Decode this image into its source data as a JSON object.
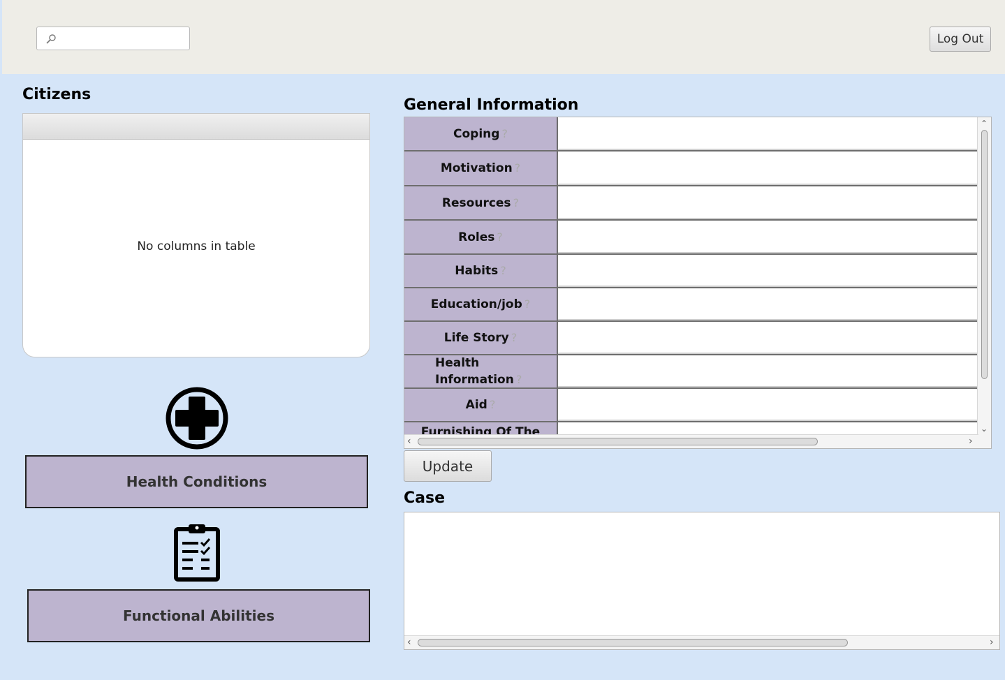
{
  "header": {
    "search": {
      "value": "",
      "placeholder": ""
    },
    "logout_label": "Log Out"
  },
  "citizens": {
    "title": "Citizens",
    "empty_message": "No columns in table"
  },
  "nav": {
    "health_conditions_label": "Health Conditions",
    "health_conditions_icon": "medical-plus-icon",
    "functional_abilities_label": "Functional Abilities",
    "functional_abilities_icon": "clipboard-checklist-icon"
  },
  "general_information": {
    "title": "General Information",
    "help_glyph": "?",
    "rows": [
      {
        "label": "Coping",
        "value": ""
      },
      {
        "label": "Motivation",
        "value": ""
      },
      {
        "label": "Resources",
        "value": ""
      },
      {
        "label": "Roles",
        "value": ""
      },
      {
        "label": "Habits",
        "value": ""
      },
      {
        "label": "Education/job",
        "value": ""
      },
      {
        "label": "Life Story",
        "value": ""
      },
      {
        "label": "Health Information",
        "value": ""
      },
      {
        "label": "Aid",
        "value": ""
      },
      {
        "label": "Furnishing Of The",
        "value": ""
      }
    ]
  },
  "update_label": "Update",
  "case": {
    "title": "Case",
    "value": ""
  },
  "colors": {
    "background": "#d5e5f8",
    "topbar": "#eeede7",
    "accent_purple": "#bdb4cf"
  }
}
